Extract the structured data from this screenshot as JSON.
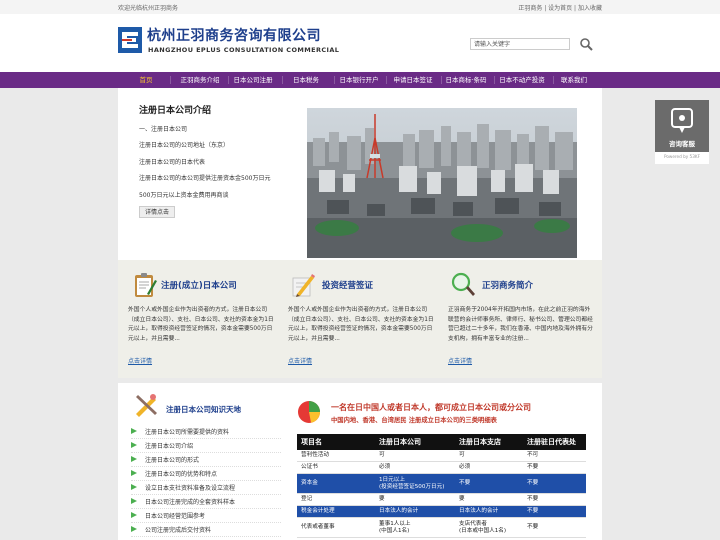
{
  "topbar": {
    "welcome": "欢迎光临杭州正羽商务",
    "links": "正羽商务 | 设为首页 | 加入收藏"
  },
  "header": {
    "logo_cn": "杭州正羽商务咨询有限公司",
    "logo_en": "HANGZHOU EPLUS CONSULTATION COMMERCIAL",
    "search_placeholder": "请输入关键字"
  },
  "nav": {
    "items": [
      {
        "label": "首页"
      },
      {
        "label": "正羽商务介绍"
      },
      {
        "label": "日本公司注册"
      },
      {
        "label": "日本税务"
      },
      {
        "label": "日本银行开户"
      },
      {
        "label": "申请日本签证"
      },
      {
        "label": "日本商标·条码"
      },
      {
        "label": "日本不动产投资"
      },
      {
        "label": "联系我们"
      }
    ]
  },
  "hero": {
    "title": "注册日本公司介绍",
    "lines": [
      "一、注册日本公司",
      "注册日本公司的公司地址（东京）",
      "注册日本公司的日本代表",
      "注册日本公司的本公司提供注册资本金500万日元",
      "500万日元以上资本金费用再商谈"
    ],
    "button": "详情点击"
  },
  "columns": [
    {
      "icon": "clipboard-pen-icon",
      "title": "注册(成立)日本公司",
      "text": "外国个人或外国企业作为出资者的方式，注册日本公司（成立日本公司）、支社、日本公司、支社的资本金为1日元以上，取得投资经营签证的情况，资本金需要500万日元以上，并且需要...",
      "link": "点击详情"
    },
    {
      "icon": "pencil-paper-icon",
      "title": "投资经营签证",
      "text": "外国个人或外国企业作为出资者的方式，注册日本公司（成立日本公司）、支社、日本公司、支社的资本金为1日元以上，取得投资经营签证的情况，资本金需要500万日元以上，并且需要...",
      "link": "点击详情"
    },
    {
      "icon": "magnifier-icon",
      "title": "正羽商务简介",
      "text": "正羽商务于2004年开拓国内市场，在此之前正羽的海外联营的会计师事务所、律师行、秘书公司、管理公司都经营已超过二十多年，我们在香港、中国内地及海外拥有分支机构，拥有丰富专业的注册...",
      "link": "点击详情"
    }
  ],
  "knowledge": {
    "title": "注册日本公司知识天地",
    "items": [
      "注册日本公司所需要提供的资料",
      "注册日本公司介绍",
      "注册日本公司的形式",
      "注册日本公司的优势和特点",
      "设立日本支社资料准备及设立流程",
      "日本公司注册完成的全套资料样本",
      "日本公司经营范围参考",
      "公司注册完成后交付资料"
    ]
  },
  "comparison": {
    "headline": "一名在日中国人或者日本人，都可成立日本公司或分公司",
    "subline": "中国内地、香港、台湾居民 注册成立日本公司的三类明细表",
    "headers": [
      "项目名",
      "注册日本公司",
      "注册日本支店",
      "注册驻日代表处"
    ],
    "rows": [
      {
        "cells": [
          "营利性活动",
          "可",
          "可",
          "不可"
        ]
      },
      {
        "cells": [
          "公证书",
          "必须",
          "必须",
          "不要"
        ]
      },
      {
        "cells": [
          "资本金",
          "1日元以上\n(投资经营签证500万日元)",
          "不要",
          "不要"
        ],
        "highlight": true,
        "tall": true
      },
      {
        "cells": [
          "登记",
          "要",
          "要",
          "不要"
        ]
      },
      {
        "cells": [
          "税金会计处理",
          "日本法人的会计",
          "日本法人的会计",
          "不要"
        ],
        "highlight": true
      },
      {
        "cells": [
          "代表或者董事",
          "董事1人以上\n(中国人1名)",
          "支店代表者\n(日本或中国人1名)",
          "不要"
        ],
        "tall": true
      }
    ]
  },
  "side_widget": {
    "label": "咨询客服",
    "powered": "Powered by 53KF"
  }
}
